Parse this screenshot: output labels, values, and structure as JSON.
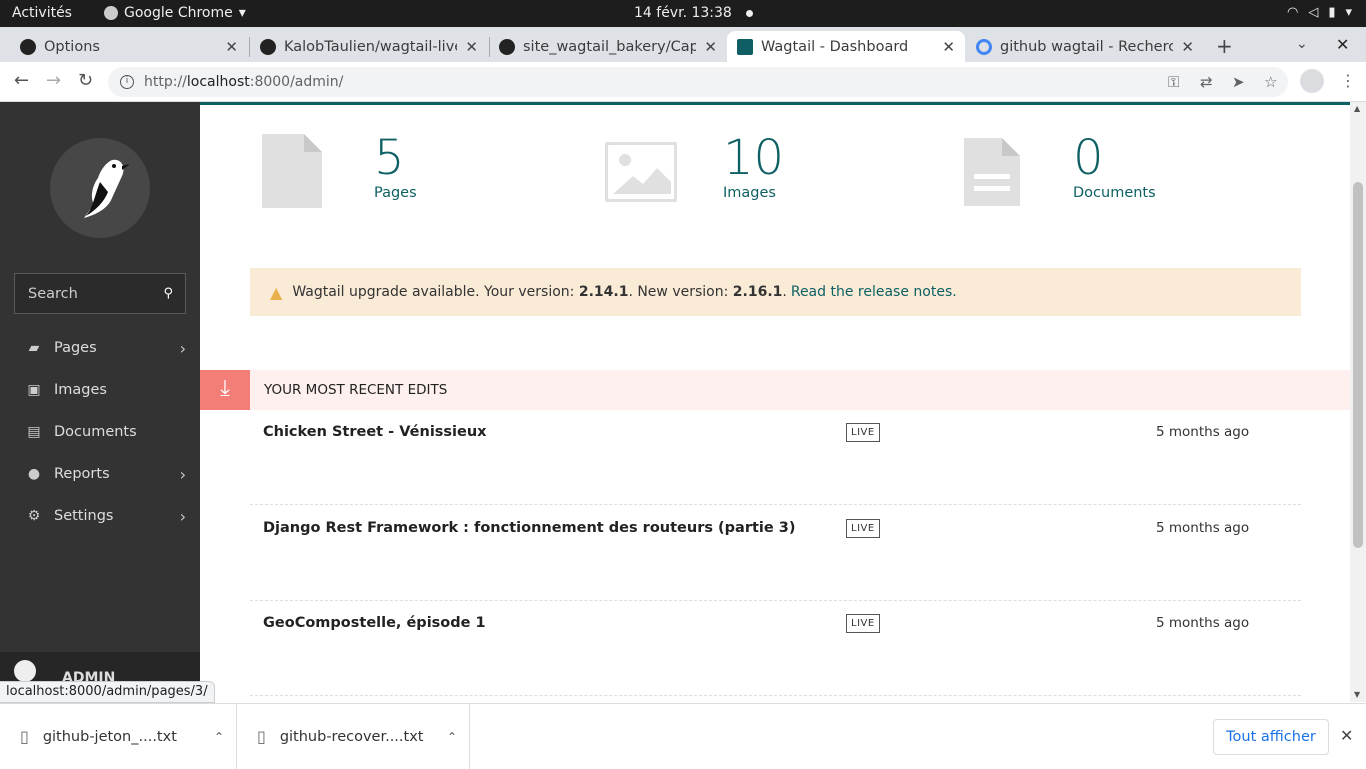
{
  "system": {
    "activities": "Activités",
    "app_name": "Google Chrome",
    "clock": "14 févr.  13:38"
  },
  "tabs": [
    {
      "label": "Options",
      "icon": "github-icon",
      "active": false
    },
    {
      "label": "KalobTaulien/wagtail-live",
      "icon": "github-icon",
      "active": false
    },
    {
      "label": "site_wagtail_bakery/Capt",
      "icon": "github-icon",
      "active": false
    },
    {
      "label": "Wagtail - Dashboard",
      "icon": "wagtail-icon",
      "active": true
    },
    {
      "label": "github wagtail - Recherch",
      "icon": "google-icon",
      "active": false
    }
  ],
  "address": {
    "url_prefix": "http://",
    "url_host": "localhost",
    "url_rest": ":8000/admin/"
  },
  "sidebar": {
    "search_placeholder": "Search",
    "items": [
      {
        "label": "Pages",
        "icon": "folder-open-icon",
        "has_submenu": true
      },
      {
        "label": "Images",
        "icon": "image-icon",
        "has_submenu": false
      },
      {
        "label": "Documents",
        "icon": "document-icon",
        "has_submenu": false
      },
      {
        "label": "Reports",
        "icon": "globe-icon",
        "has_submenu": true
      },
      {
        "label": "Settings",
        "icon": "cogs-icon",
        "has_submenu": true
      }
    ],
    "account_name": "ADMIN"
  },
  "summary": [
    {
      "count": "5",
      "label": "Pages"
    },
    {
      "count": "10",
      "label": "Images"
    },
    {
      "count": "0",
      "label": "Documents"
    }
  ],
  "upgrade": {
    "text_before": "Wagtail upgrade available. Your version: ",
    "current_version": "2.14.1",
    "text_middle": ". New version: ",
    "new_version": "2.16.1",
    "text_after": ".",
    "link_text": "Read the release notes."
  },
  "recent_edits": {
    "heading": "YOUR MOST RECENT EDITS",
    "rows": [
      {
        "title": "Chicken Street - Vénissieux",
        "status": "LIVE",
        "when": "5 months ago"
      },
      {
        "title": "Django Rest Framework : fonctionnement des routeurs (partie 3)",
        "status": "LIVE",
        "when": "5 months ago"
      },
      {
        "title": "GeoCompostelle, épisode 1",
        "status": "LIVE",
        "when": "5 months ago"
      }
    ]
  },
  "status_link": "localhost:8000/admin/pages/3/",
  "downloads": {
    "files": [
      {
        "name": "github-jeton_....txt"
      },
      {
        "name": "github-recover....txt"
      }
    ],
    "show_all": "Tout afficher"
  }
}
